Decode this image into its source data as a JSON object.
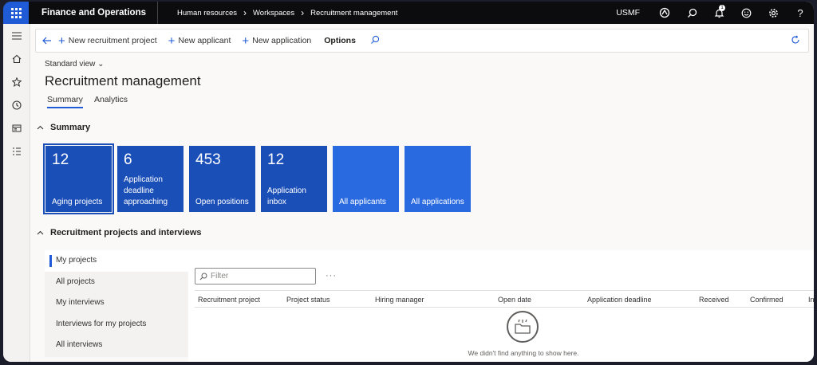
{
  "topbar": {
    "app_title": "Finance and Operations",
    "breadcrumb": [
      "Human resources",
      "Workspaces",
      "Recruitment management"
    ],
    "company": "USMF",
    "notification_count": "1"
  },
  "actions": {
    "new_recruitment_project": "New recruitment project",
    "new_applicant": "New applicant",
    "new_application": "New application",
    "options": "Options"
  },
  "page": {
    "view": "Standard view",
    "title": "Recruitment management",
    "tabs": [
      "Summary",
      "Analytics"
    ]
  },
  "summary": {
    "heading": "Summary",
    "tiles": [
      {
        "count": "12",
        "label": "Aging projects"
      },
      {
        "count": "6",
        "label": "Application deadline approaching"
      },
      {
        "count": "453",
        "label": "Open positions"
      },
      {
        "count": "12",
        "label": "Application inbox"
      },
      {
        "count": "",
        "label": "All applicants"
      },
      {
        "count": "",
        "label": "All applications"
      }
    ]
  },
  "projects": {
    "heading": "Recruitment projects and interviews",
    "nav": [
      "My projects",
      "All projects",
      "My interviews",
      "Interviews for my projects",
      "All interviews"
    ],
    "filter_placeholder": "Filter",
    "columns": [
      "Recruitment project",
      "Project status",
      "Hiring manager",
      "Open date",
      "Application deadline",
      "Received",
      "Confirmed",
      "In"
    ],
    "empty_message": "We didn't find anything to show here."
  },
  "colors": {
    "accent": "#1f5bd6",
    "tile_dark": "#1b4fb8",
    "tile_light": "#2a6ae0",
    "topbar": "#0c0c0f"
  }
}
